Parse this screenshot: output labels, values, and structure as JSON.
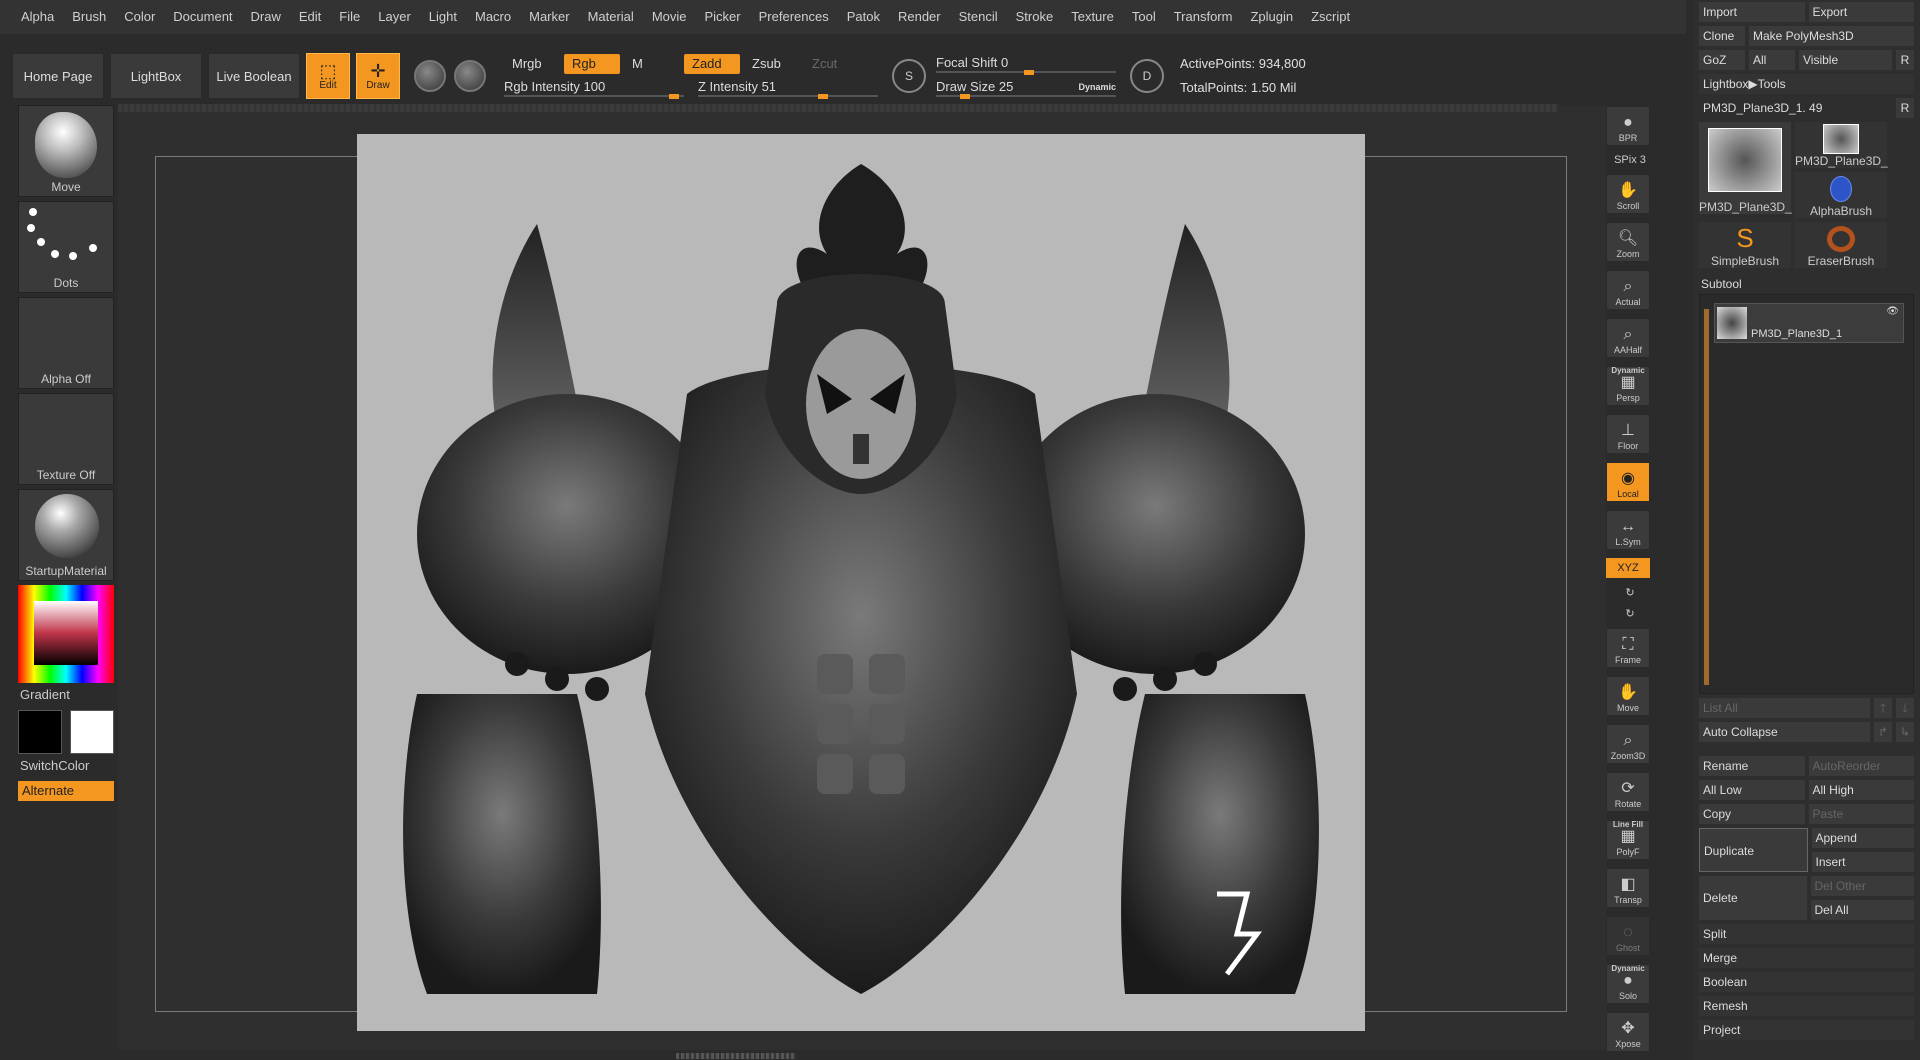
{
  "menu": [
    "Alpha",
    "Brush",
    "Color",
    "Document",
    "Draw",
    "Edit",
    "File",
    "Layer",
    "Light",
    "Macro",
    "Marker",
    "Material",
    "Movie",
    "Picker",
    "Preferences",
    "Patok",
    "Render",
    "Stencil",
    "Stroke",
    "Texture",
    "Tool",
    "Transform",
    "Zplugin",
    "Zscript"
  ],
  "toolbar": {
    "home": "Home Page",
    "lightbox": "LightBox",
    "live_boolean": "Live Boolean",
    "edit": "Edit",
    "draw": "Draw",
    "mrgb": "Mrgb",
    "rgb": "Rgb",
    "m": "M",
    "zadd": "Zadd",
    "zsub": "Zsub",
    "zcut": "Zcut",
    "rgb_intensity": "Rgb Intensity 100",
    "z_intensity": "Z Intensity 51",
    "focal_shift": "Focal Shift 0",
    "draw_size": "Draw Size 25",
    "dynamic": "Dynamic",
    "active_points": "ActivePoints: 934,800",
    "total_points": "TotalPoints: 1.50 Mil",
    "s_label": "S",
    "d_label": "D"
  },
  "left": {
    "brush": "Move",
    "stroke": "Dots",
    "alpha": "Alpha Off",
    "texture": "Texture Off",
    "material": "StartupMaterial",
    "gradient": "Gradient",
    "switch_color": "SwitchColor",
    "alternate": "Alternate",
    "colors": {
      "primary": "#000000",
      "secondary": "#ffffff",
      "accent": "#f39720"
    }
  },
  "shelf": {
    "bpr": "BPR",
    "spix": "SPix 3",
    "scroll": "Scroll",
    "zoom": "Zoom",
    "actual": "Actual",
    "aahalf": "AAHalf",
    "dynamic": "Dynamic",
    "persp": "Persp",
    "floor": "Floor",
    "local": "Local",
    "lsym": "L.Sym",
    "xyz": "XYZ",
    "frame": "Frame",
    "move": "Move",
    "zoom3d": "Zoom3D",
    "rotate": "Rotate",
    "linefill": "Line Fill",
    "polyf": "PolyF",
    "transp": "Transp",
    "ghost": "Ghost",
    "dynamic2": "Dynamic",
    "solo": "Solo",
    "xpose": "Xpose"
  },
  "right": {
    "import": "Import",
    "export": "Export",
    "clone": "Clone",
    "make_polymesh": "Make PolyMesh3D",
    "goz": "GoZ",
    "all": "All",
    "visible": "Visible",
    "r": "R",
    "lightbox_tools": "Lightbox▶Tools",
    "current_tool": "PM3D_Plane3D_1. 49",
    "tools": [
      "PM3D_Plane3D_",
      "PM3D_Plane3D_",
      "AlphaBrush",
      "SimpleBrush",
      "EraserBrush"
    ],
    "subtool_head": "Subtool",
    "subtool_name": "PM3D_Plane3D_1",
    "list_all": "List All",
    "auto_collapse": "Auto Collapse",
    "rename": "Rename",
    "auto_reorder": "AutoReorder",
    "all_low": "All Low",
    "all_high": "All High",
    "copy": "Copy",
    "paste": "Paste",
    "duplicate": "Duplicate",
    "append": "Append",
    "insert": "Insert",
    "delete": "Delete",
    "del_other": "Del Other",
    "del_all": "Del All",
    "split": "Split",
    "merge": "Merge",
    "boolean": "Boolean",
    "remesh": "Remesh",
    "project": "Project"
  }
}
